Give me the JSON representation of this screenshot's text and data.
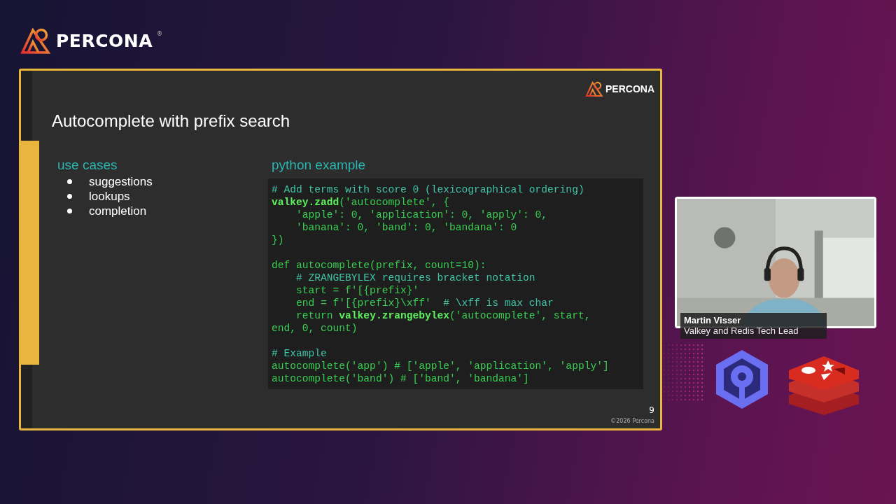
{
  "brand": {
    "name": "PERCONA",
    "mark": "®"
  },
  "slide": {
    "logo": "PERCONA",
    "title": "Autocomplete with prefix search",
    "left": {
      "heading": "use cases",
      "bullets": [
        "suggestions",
        "lookups",
        "completion"
      ]
    },
    "right": {
      "heading": "python example",
      "code_blocks": [
        [
          [
            {
              "kind": "comment",
              "text": "# Add terms with score 0 (lexicographical ordering)"
            }
          ],
          [
            {
              "kind": "call",
              "text": "valkey.zadd"
            },
            {
              "kind": "code",
              "text": "('autocomplete', {"
            }
          ],
          [
            {
              "kind": "code",
              "text": "    'apple': 0, 'application': 0, 'apply': 0,"
            }
          ],
          [
            {
              "kind": "code",
              "text": "    'banana': 0, 'band': 0, 'bandana': 0"
            }
          ],
          [
            {
              "kind": "code",
              "text": "})"
            }
          ]
        ],
        [
          [
            {
              "kind": "code",
              "text": "def autocomplete(prefix, count=10):"
            }
          ],
          [
            {
              "kind": "comment",
              "text": "    # ZRANGEBYLEX requires bracket notation"
            }
          ],
          [
            {
              "kind": "code",
              "text": "    start = f'[{prefix}'"
            }
          ],
          [
            {
              "kind": "code",
              "text": "    end = f'[{prefix}\\xff'  "
            },
            {
              "kind": "comment",
              "text": "# \\xff is max char"
            }
          ],
          [
            {
              "kind": "code",
              "text": "    return "
            },
            {
              "kind": "call",
              "text": "valkey.zrangebylex"
            },
            {
              "kind": "code",
              "text": "('autocomplete', start,"
            }
          ],
          [
            {
              "kind": "code",
              "text": "end, 0, count)"
            }
          ]
        ],
        [
          [
            {
              "kind": "comment",
              "text": "# Example"
            }
          ],
          [
            {
              "kind": "code",
              "text": "autocomplete('app') # ['apple', 'application', 'apply']"
            }
          ],
          [
            {
              "kind": "code",
              "text": "autocomplete('band') # ['band', 'bandana']"
            }
          ]
        ]
      ]
    },
    "page_number": "9",
    "copyright": "©2026 Percona"
  },
  "speaker": {
    "name": "Martin Visser",
    "role": "Valkey and Redis Tech Lead"
  }
}
